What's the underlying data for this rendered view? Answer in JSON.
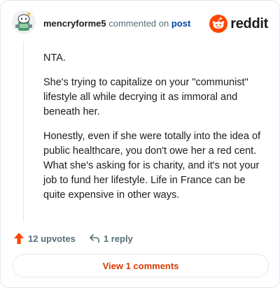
{
  "header": {
    "username": "mencryforme5",
    "action_text": "commented on",
    "post_link": "post",
    "brand_name": "reddit",
    "avatar_icon": "snoo-avatar-icon",
    "brand_icon": "reddit-logo-icon"
  },
  "comment": {
    "paragraphs": [
      "NTA.",
      "She's trying to capitalize on your \"communist\" lifestyle all while decrying it as immoral and beneath her.",
      "Honestly, even if she were totally into the idea of public healthcare, you don't owe her a red cent. What she's asking for is charity, and it's not your job to fund her lifestyle. Life in France can be quite expensive in other ways."
    ]
  },
  "actions": {
    "upvotes": "12 upvotes",
    "reply": "1 reply",
    "upvote_icon": "upvote-arrow-icon",
    "reply_icon": "reply-arrow-icon"
  },
  "footer": {
    "view_comments": "View 1 comments"
  },
  "colors": {
    "accent": "#d93a00",
    "reddit_orange": "#ff4500",
    "link_blue": "#0045ac",
    "muted": "#576f76"
  }
}
